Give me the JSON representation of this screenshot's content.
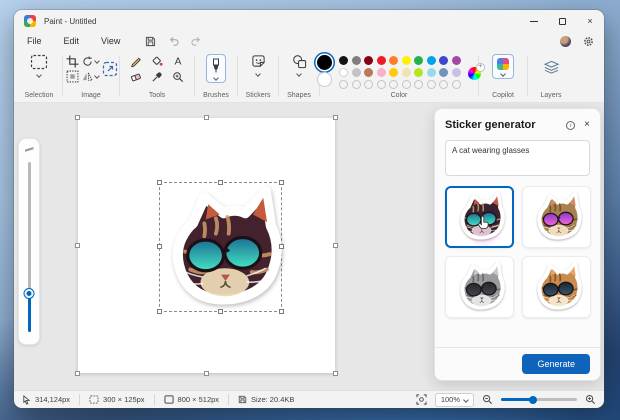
{
  "window": {
    "title": "Paint - Untitled"
  },
  "menu": {
    "items": [
      {
        "label": "File"
      },
      {
        "label": "Edit"
      },
      {
        "label": "View"
      }
    ]
  },
  "toolbar": {
    "groups": {
      "selection": {
        "label": "Selection"
      },
      "image": {
        "label": "Image"
      },
      "tools": {
        "label": "Tools"
      },
      "brushes": {
        "label": "Brushes"
      },
      "stickers": {
        "label": "Stickers"
      },
      "shapes": {
        "label": "Shapes"
      },
      "color": {
        "label": "Color"
      },
      "copilot": {
        "label": "Copilot"
      },
      "layers": {
        "label": "Layers"
      }
    },
    "text_tool_glyph": "A"
  },
  "colors": {
    "selected_primary": "#000000",
    "secondary": "#ffffff",
    "accent": "#0067c0",
    "palette_row1": [
      "#121212",
      "#7f7f7f",
      "#880015",
      "#ed1c24",
      "#ff7f27",
      "#fef200",
      "#22b14c",
      "#00a2e8",
      "#3f48cc",
      "#a349a4"
    ],
    "palette_row2": [
      "#ffffff",
      "#c3c3c3",
      "#b97a57",
      "#ffaec9",
      "#ffc90e",
      "#efe4b0",
      "#b5e61d",
      "#99d9ea",
      "#7092be",
      "#c8bfe7"
    ],
    "empty_slots": 10
  },
  "sticker_panel": {
    "title": "Sticker generator",
    "prompt_text": "A cat wearing glasses",
    "generate_label": "Generate",
    "thumbnails": [
      {
        "name": "cat-teal-sunglasses",
        "selected": true
      },
      {
        "name": "cat-purple-sunglasses",
        "selected": false
      },
      {
        "name": "gray-cat-round-glasses",
        "selected": false
      },
      {
        "name": "tabby-cat-round-glasses",
        "selected": false
      }
    ]
  },
  "statusbar": {
    "cursor_pos": "314,124px",
    "selection_size": "300 × 125px",
    "canvas_size": "800 × 512px",
    "file_size": "Size: 20.4KB",
    "zoom_value": "100%"
  },
  "icons": {
    "close_glyph": "×"
  }
}
